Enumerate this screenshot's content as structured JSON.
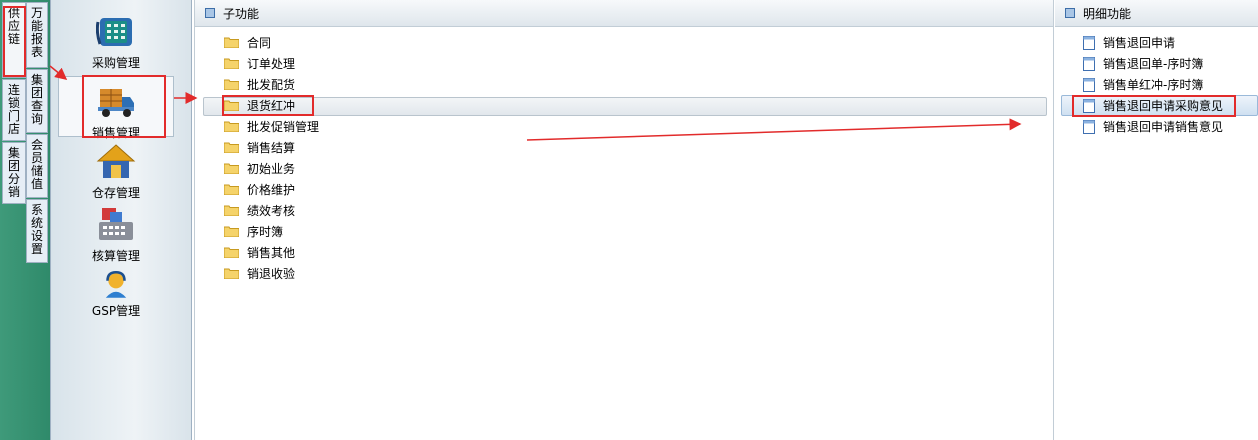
{
  "colors": {
    "accent_red": "#e22b2b",
    "strip_green": "#3f9a7a",
    "panel_bg": "#dfe6ec"
  },
  "left_tabs": [
    {
      "label": "供应链",
      "active": true
    },
    {
      "label": "连锁门店"
    },
    {
      "label": "集团分销"
    }
  ],
  "inner_tabs": [
    {
      "label": "万能报表"
    },
    {
      "label": "集团查询"
    },
    {
      "label": "会员储值"
    },
    {
      "label": "系统设置"
    }
  ],
  "modules": [
    {
      "label": "采购管理",
      "icon": "phone-calculator-icon"
    },
    {
      "label": "销售管理",
      "icon": "delivery-truck-icon",
      "selected": true
    },
    {
      "label": "仓存管理",
      "icon": "warehouse-house-icon"
    },
    {
      "label": "核算管理",
      "icon": "cash-register-icon"
    },
    {
      "label": "GSP管理",
      "icon": "support-person-icon"
    }
  ],
  "sub_panel": {
    "title": "子功能",
    "items": [
      "合同",
      "订单处理",
      "批发配货",
      "退货红冲",
      "批发促销管理",
      "销售结算",
      "初始业务",
      "价格维护",
      "绩效考核",
      "序时簿",
      "销售其他",
      "销退收验"
    ],
    "selected_index": 3
  },
  "detail_panel": {
    "title": "明细功能",
    "items": [
      "销售退回申请",
      "销售退回单-序时簿",
      "销售单红冲-序时簿",
      "销售退回申请采购意见",
      "销售退回申请销售意见"
    ],
    "selected_index": 3
  }
}
